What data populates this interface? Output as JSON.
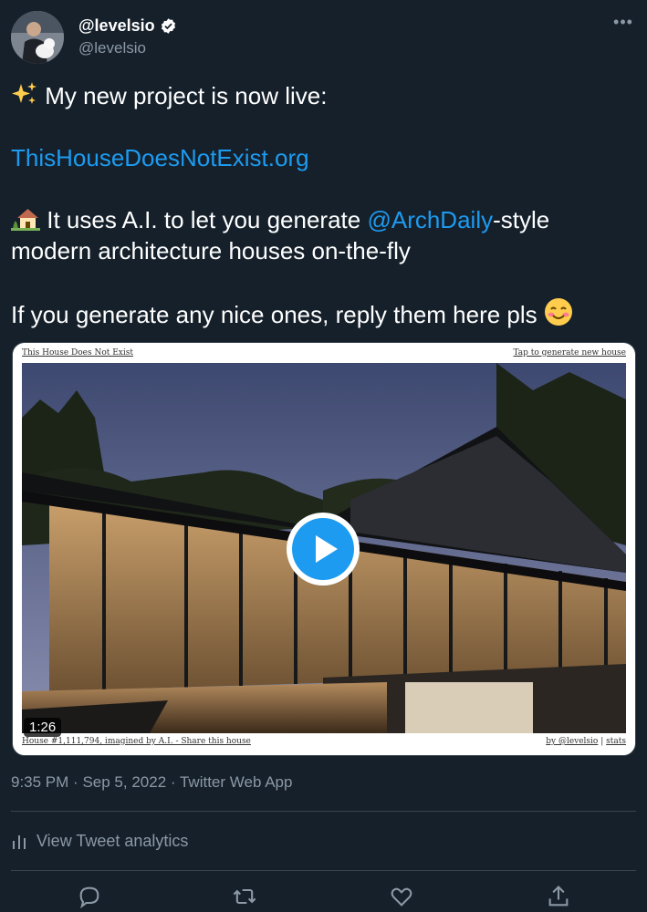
{
  "user": {
    "display_name": "@levelsio",
    "handle": "@levelsio"
  },
  "tweet": {
    "line1": "My new project is now live:",
    "link": "ThisHouseDoesNotExist.org",
    "line3_prefix": "It uses A.I. to let you generate ",
    "mention": "@ArchDaily",
    "line3_suffix": "-style modern architecture houses on-the-fly",
    "line4": "If you generate any nice ones, reply them here pls"
  },
  "media": {
    "site_title": "This House Does Not Exist",
    "site_action": "Tap to generate new house",
    "caption": "House #1,111,794, imagined by A.I. - Share this house",
    "credit": "by @levelsio",
    "separator": "|",
    "stats": "stats",
    "duration": "1:26"
  },
  "meta": {
    "time": "9:35 PM",
    "dot1": "·",
    "date": "Sep 5, 2022",
    "dot2": "·",
    "source": "Twitter Web App"
  },
  "analytics_label": "View Tweet analytics",
  "icons": {
    "more": "more-icon",
    "verified": "verified-badge-icon",
    "reply": "reply-icon",
    "retweet": "retweet-icon",
    "like": "like-icon",
    "share": "share-icon",
    "analytics": "analytics-icon"
  },
  "colors": {
    "background": "#15202b",
    "link": "#1d9bf0",
    "muted": "#8b98a5"
  }
}
